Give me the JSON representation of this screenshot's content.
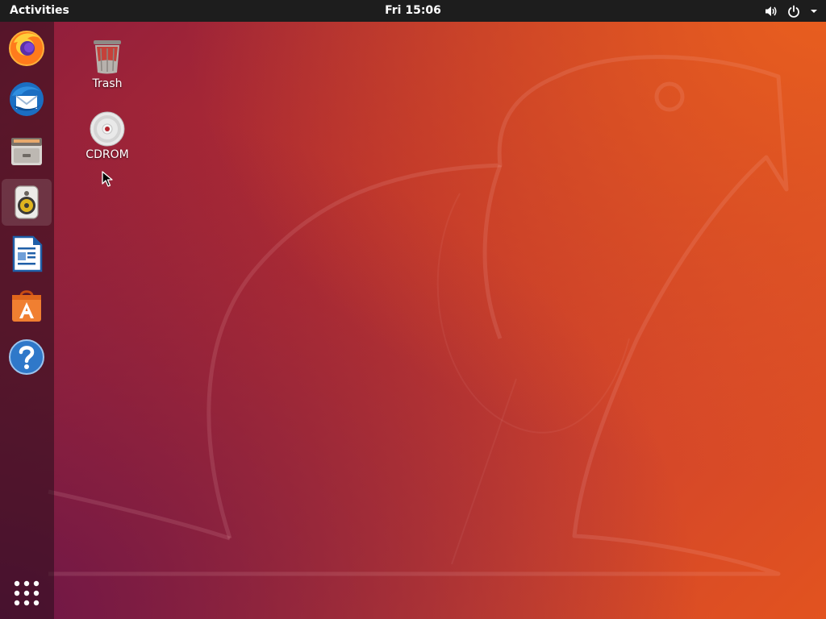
{
  "top_bar": {
    "activities_label": "Activities",
    "clock": "Fri 15:06",
    "tray_icons": [
      "volume-icon",
      "power-icon",
      "dropdown-arrow-icon"
    ]
  },
  "dock": {
    "items": [
      {
        "name": "Firefox",
        "icon": "firefox-icon"
      },
      {
        "name": "Thunderbird",
        "icon": "thunderbird-icon"
      },
      {
        "name": "Files",
        "icon": "files-icon"
      },
      {
        "name": "Rhythmbox",
        "icon": "rhythmbox-icon",
        "active": true
      },
      {
        "name": "LibreOffice Writer",
        "icon": "libreoffice-writer-icon"
      },
      {
        "name": "Ubuntu Software",
        "icon": "ubuntu-software-icon"
      },
      {
        "name": "Help",
        "icon": "help-icon"
      }
    ],
    "show_apps_icon": "show-applications-icon"
  },
  "desktop_icons": [
    {
      "label": "Trash",
      "icon": "trash-icon"
    },
    {
      "label": "CDROM",
      "icon": "cdrom-icon"
    }
  ],
  "colors": {
    "panel": "#1d1d1d",
    "wallpaper_orange": "#e95f1e",
    "wallpaper_purple": "#6d1647"
  }
}
